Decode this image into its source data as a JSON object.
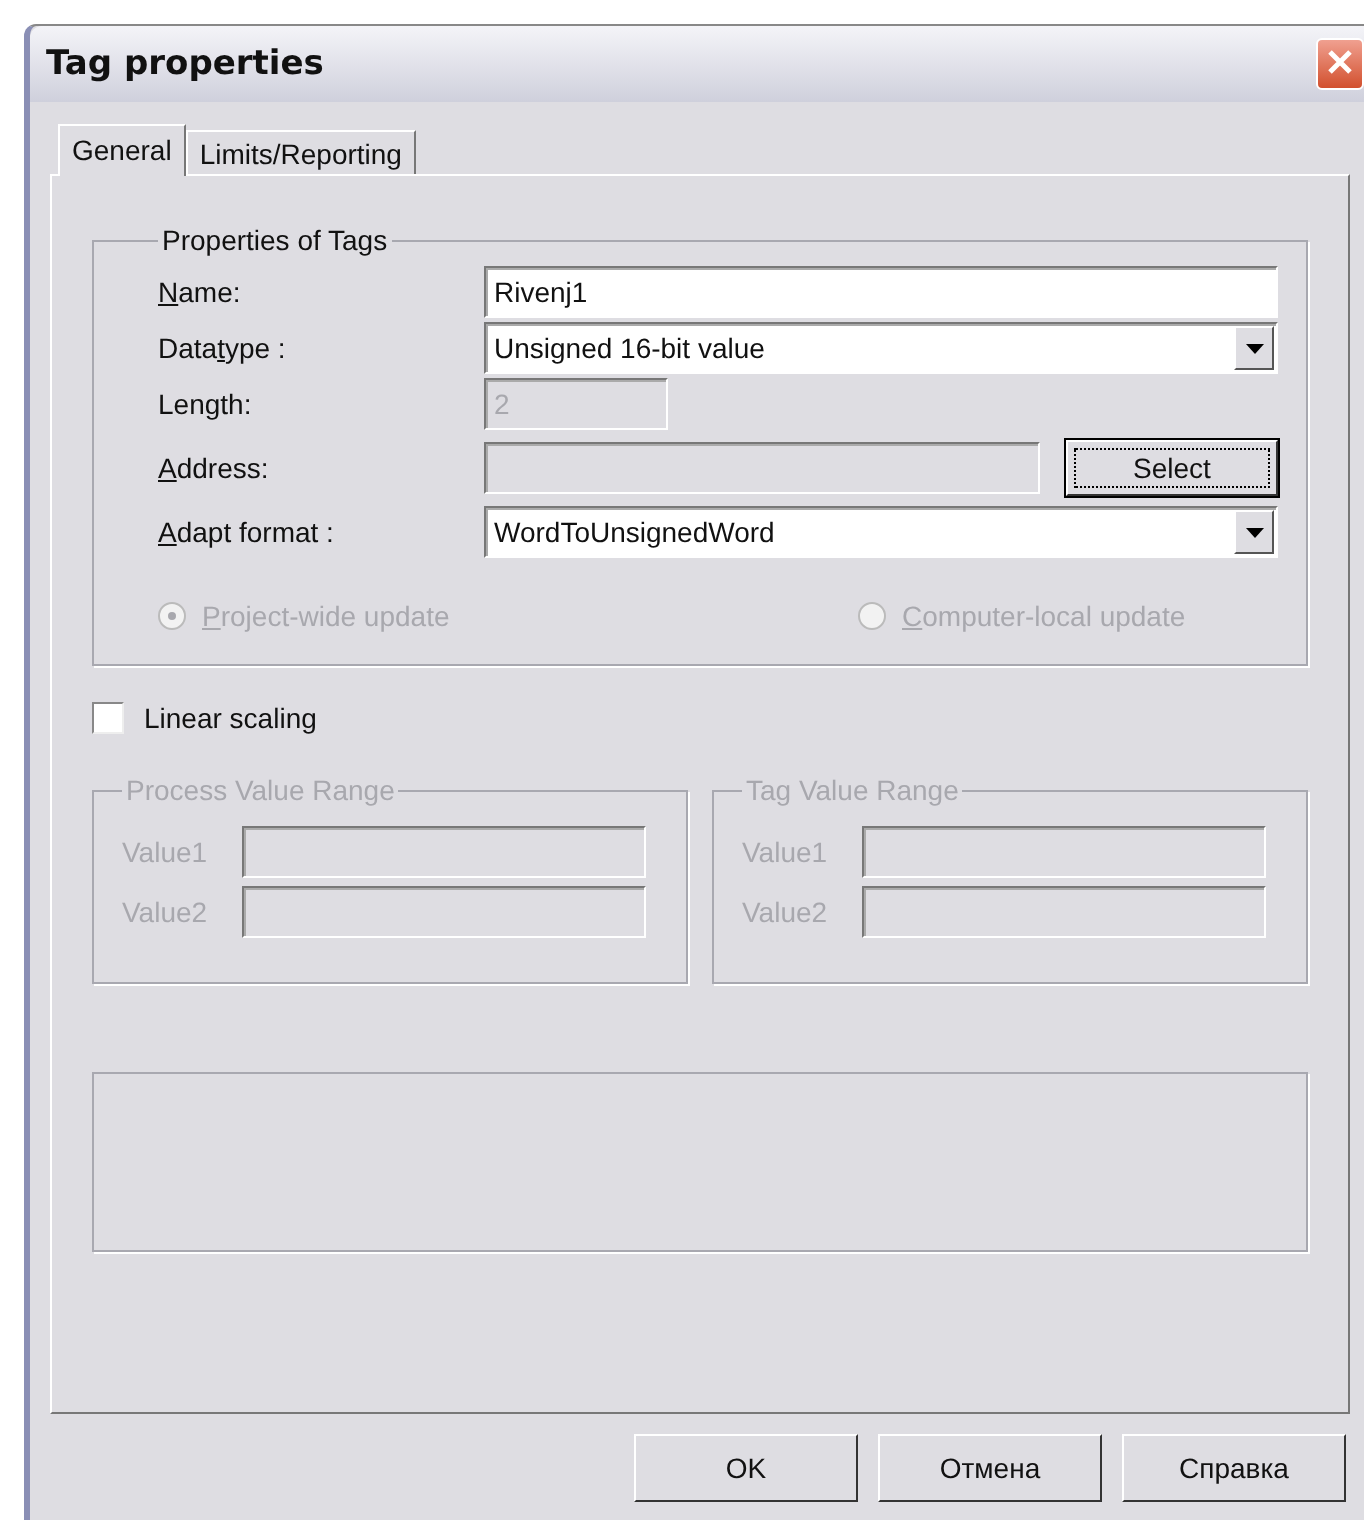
{
  "window": {
    "title": "Tag properties"
  },
  "tabs": [
    {
      "label": "General",
      "selected": true
    },
    {
      "label": "Limits/Reporting",
      "selected": false
    }
  ],
  "properties_group": {
    "title": "Properties of Tags",
    "fields": [
      {
        "kind": "text",
        "label": {
          "key": "N",
          "post": "ame:"
        },
        "value": "Rivenj1",
        "disabled": false
      },
      {
        "kind": "dropdown",
        "label": {
          "pre": "Data",
          "key": "t",
          "post": "ype :"
        },
        "value": "Unsigned 16-bit value",
        "disabled": false
      },
      {
        "kind": "short",
        "label": {
          "pre": "Length:"
        },
        "value": "2",
        "disabled": true
      },
      {
        "kind": "button",
        "label": {
          "key": "A",
          "post": "ddress:"
        },
        "disabled": true,
        "button": "Select",
        "focused": true
      },
      {
        "kind": "dropdown",
        "label": {
          "key": "A",
          "post": "dapt format :"
        },
        "value": "WordToUnsignedWord",
        "disabled": false
      }
    ],
    "update_options": [
      {
        "label": {
          "key": "P",
          "post": "roject-wide update"
        },
        "selected": true,
        "disabled": true
      },
      {
        "label": {
          "key": "C",
          "post": "omputer-local update"
        },
        "selected": false,
        "disabled": true
      }
    ]
  },
  "linear_scaling": {
    "label": "Linear scaling",
    "checked": false
  },
  "ranges": [
    {
      "title": "Process Value Range",
      "disabled": true,
      "rows": [
        {
          "label": "Value1"
        },
        {
          "label": "Value2"
        }
      ]
    },
    {
      "title": "Tag Value Range",
      "disabled": true,
      "rows": [
        {
          "label": "Value1"
        },
        {
          "label": "Value2"
        }
      ]
    }
  ],
  "buttons": [
    {
      "label": "OK"
    },
    {
      "label": "Отмена"
    },
    {
      "label": "Справка"
    }
  ]
}
